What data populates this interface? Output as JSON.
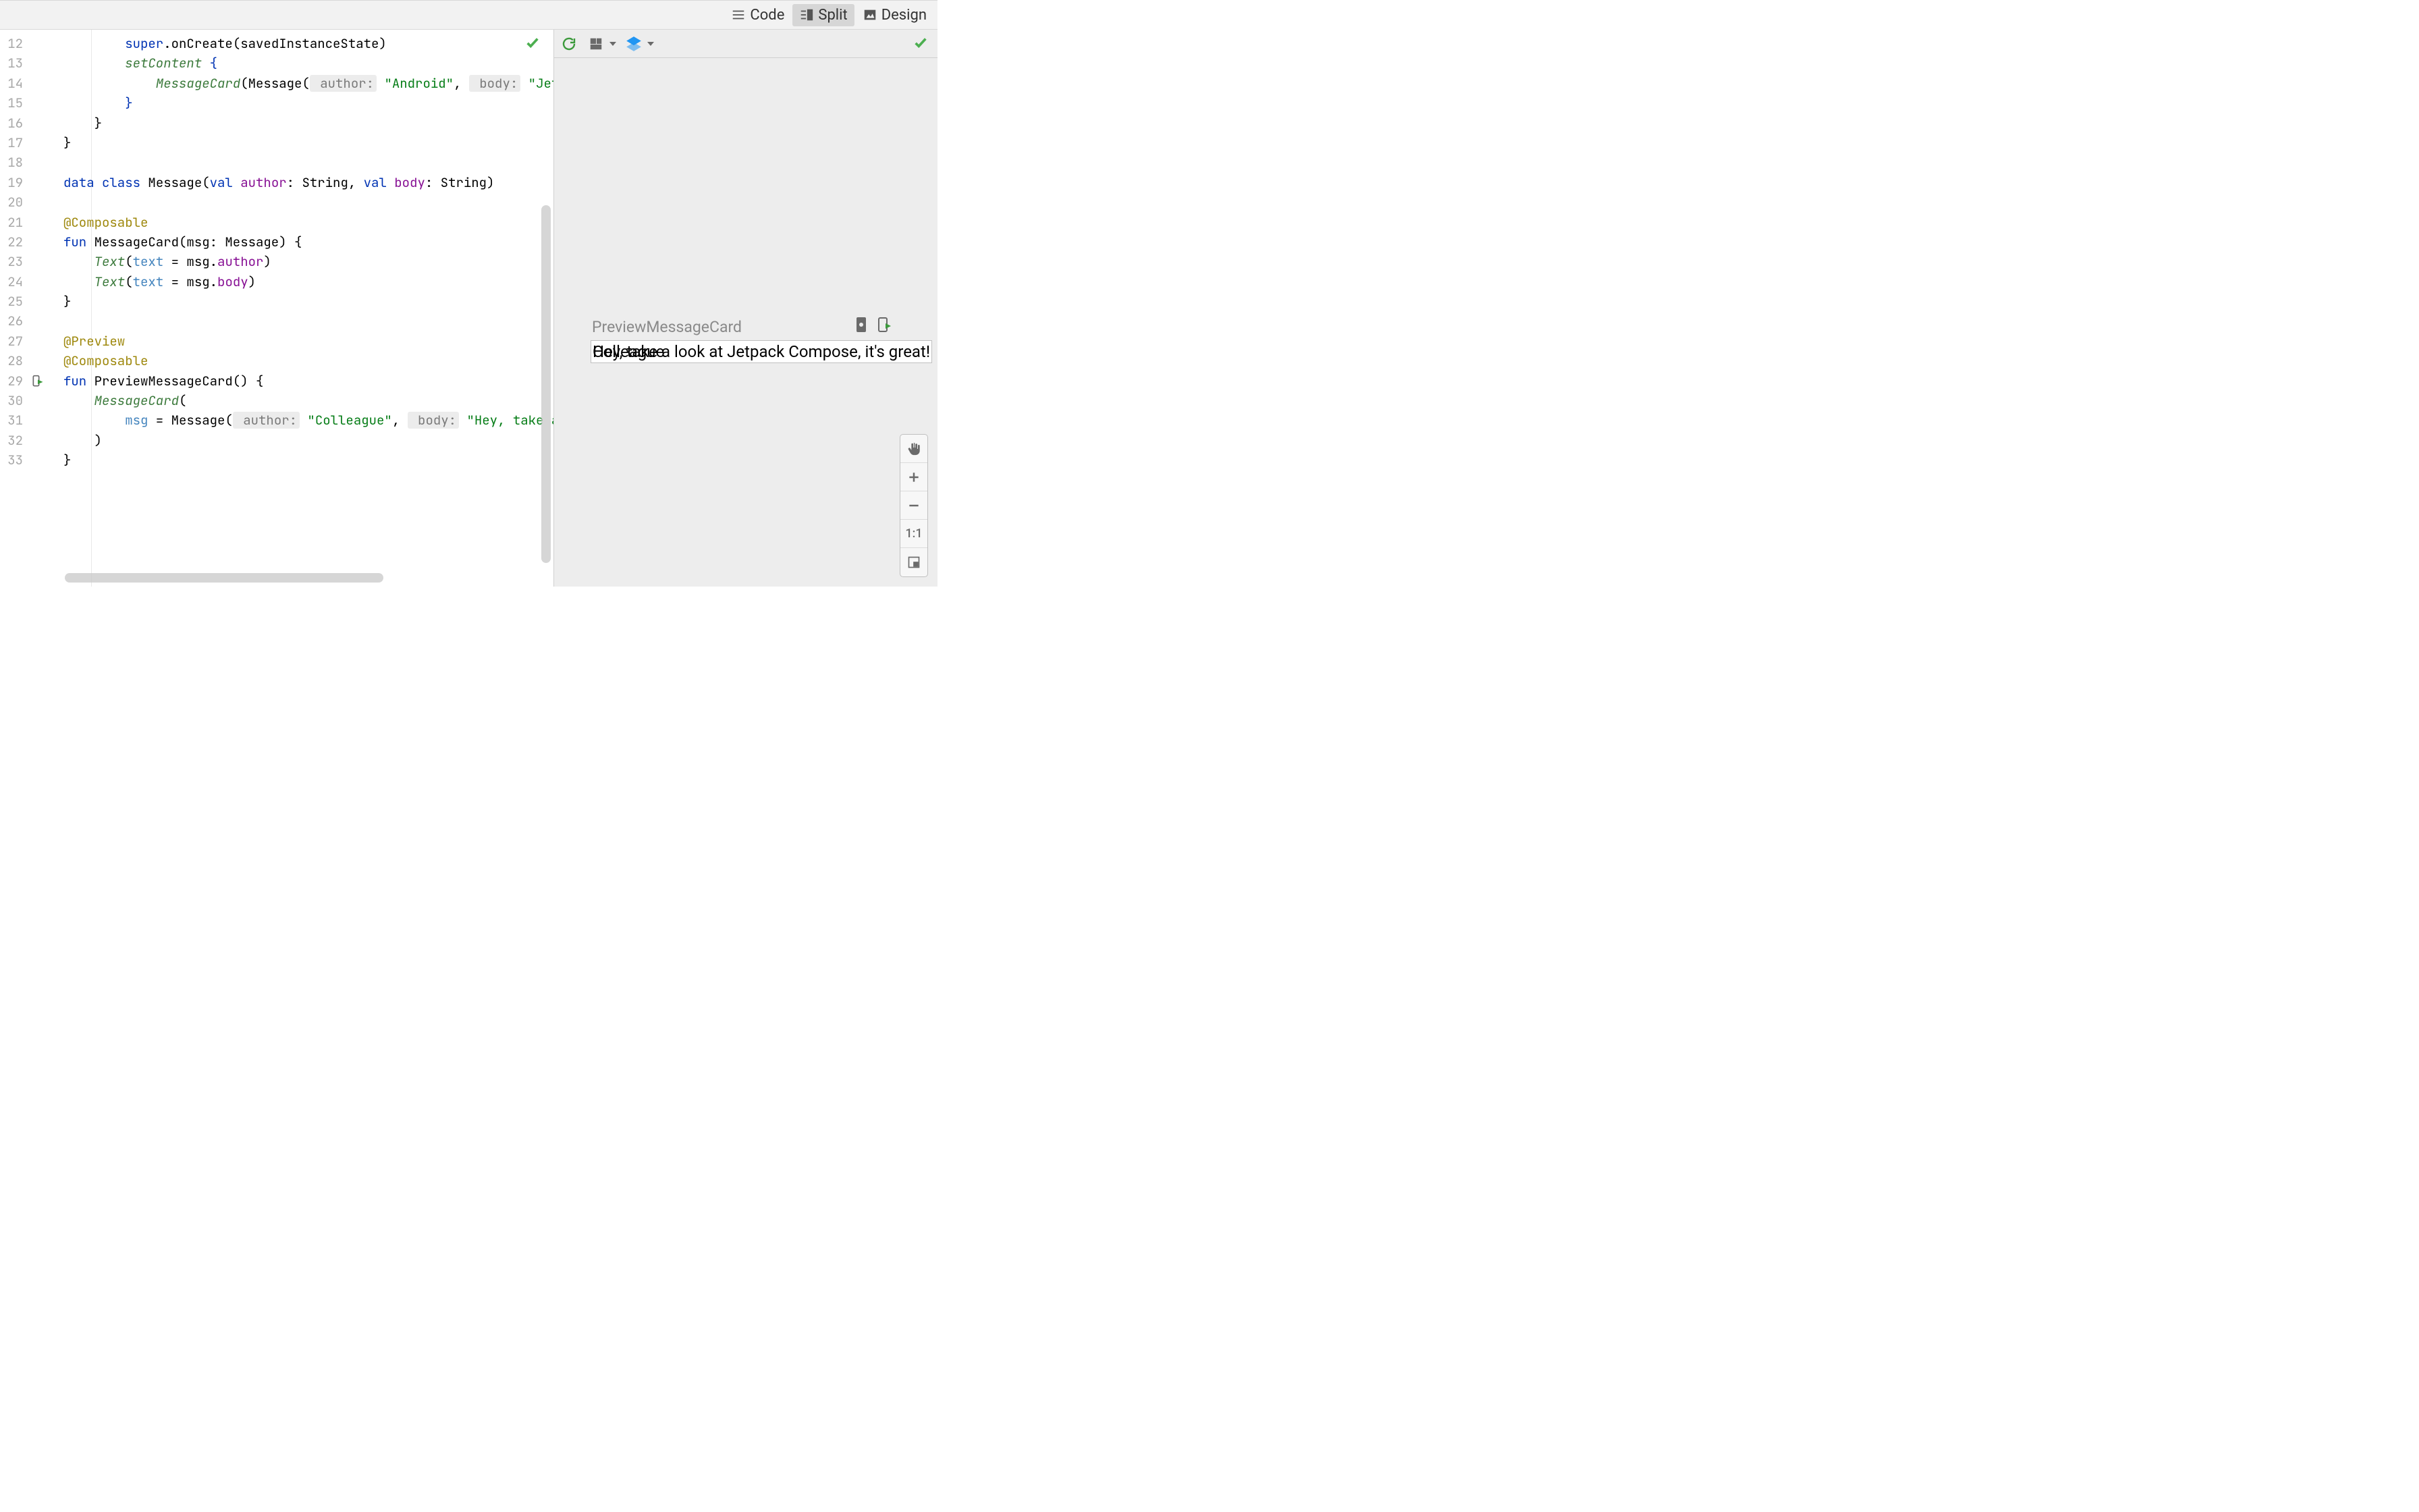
{
  "top": {
    "modes": {
      "code": "Code",
      "split": "Split",
      "design": "Design",
      "active": "split"
    }
  },
  "editor": {
    "first_line": 12,
    "run_gutter_line": 29,
    "lines": [
      {
        "i": "        ",
        "t": [
          {
            "c": "kwsuper",
            "v": "super"
          },
          {
            "c": "",
            "v": ".onCreate(savedInstanceState)"
          }
        ]
      },
      {
        "i": "        ",
        "t": [
          {
            "c": "fn-call",
            "v": "setContent"
          },
          {
            "c": "",
            "v": " "
          },
          {
            "c": "kw",
            "v": "{"
          }
        ]
      },
      {
        "i": "            ",
        "t": [
          {
            "c": "fn-call",
            "v": "MessageCard"
          },
          {
            "c": "",
            "v": "(Message("
          },
          {
            "c": "param-hint",
            "v": " author:"
          },
          {
            "c": "",
            "v": " "
          },
          {
            "c": "str",
            "v": "\"Android\""
          },
          {
            "c": "",
            "v": ", "
          },
          {
            "c": "param-hint",
            "v": " body:"
          },
          {
            "c": "",
            "v": " "
          },
          {
            "c": "str",
            "v": "\"Jetpack Compose\""
          }
        ]
      },
      {
        "i": "        ",
        "t": [
          {
            "c": "kw",
            "v": "}"
          }
        ]
      },
      {
        "i": "    ",
        "t": [
          {
            "c": "",
            "v": "}"
          }
        ]
      },
      {
        "i": "",
        "t": [
          {
            "c": "",
            "v": "}"
          }
        ]
      },
      {
        "i": "",
        "t": []
      },
      {
        "i": "",
        "t": [
          {
            "c": "kw",
            "v": "data class"
          },
          {
            "c": "",
            "v": " Message("
          },
          {
            "c": "kw",
            "v": "val"
          },
          {
            "c": "",
            "v": " "
          },
          {
            "c": "member",
            "v": "author"
          },
          {
            "c": "",
            "v": ": String, "
          },
          {
            "c": "kw",
            "v": "val"
          },
          {
            "c": "",
            "v": " "
          },
          {
            "c": "member",
            "v": "body"
          },
          {
            "c": "",
            "v": ": String)"
          }
        ]
      },
      {
        "i": "",
        "t": []
      },
      {
        "i": "",
        "t": [
          {
            "c": "anno",
            "v": "@Composable"
          }
        ]
      },
      {
        "i": "",
        "t": [
          {
            "c": "kw",
            "v": "fun"
          },
          {
            "c": "",
            "v": " MessageCard(msg: Message) {"
          }
        ]
      },
      {
        "i": "    ",
        "t": [
          {
            "c": "fn-call",
            "v": "Text"
          },
          {
            "c": "",
            "v": "("
          },
          {
            "c": "named-arg",
            "v": "text"
          },
          {
            "c": "",
            "v": " = msg."
          },
          {
            "c": "member",
            "v": "author"
          },
          {
            "c": "",
            "v": ")"
          }
        ]
      },
      {
        "i": "    ",
        "t": [
          {
            "c": "fn-call",
            "v": "Text"
          },
          {
            "c": "",
            "v": "("
          },
          {
            "c": "named-arg",
            "v": "text"
          },
          {
            "c": "",
            "v": " = msg."
          },
          {
            "c": "member",
            "v": "body"
          },
          {
            "c": "",
            "v": ")"
          }
        ]
      },
      {
        "i": "",
        "t": [
          {
            "c": "",
            "v": "}"
          }
        ]
      },
      {
        "i": "",
        "t": []
      },
      {
        "i": "",
        "t": [
          {
            "c": "anno",
            "v": "@Preview"
          }
        ]
      },
      {
        "i": "",
        "t": [
          {
            "c": "anno",
            "v": "@Composable"
          }
        ]
      },
      {
        "i": "",
        "t": [
          {
            "c": "kw",
            "v": "fun"
          },
          {
            "c": "",
            "v": " PreviewMessageCard() {"
          }
        ]
      },
      {
        "i": "    ",
        "t": [
          {
            "c": "fn-call",
            "v": "MessageCard"
          },
          {
            "c": "",
            "v": "("
          }
        ]
      },
      {
        "i": "        ",
        "t": [
          {
            "c": "named-arg",
            "v": "msg"
          },
          {
            "c": "",
            "v": " = Message("
          },
          {
            "c": "param-hint",
            "v": " author:"
          },
          {
            "c": "",
            "v": " "
          },
          {
            "c": "str",
            "v": "\"Colleague\""
          },
          {
            "c": "",
            "v": ", "
          },
          {
            "c": "param-hint",
            "v": " body:"
          },
          {
            "c": "",
            "v": " "
          },
          {
            "c": "str",
            "v": "\"Hey, take a look at"
          }
        ]
      },
      {
        "i": "    ",
        "t": [
          {
            "c": "",
            "v": ")"
          }
        ]
      },
      {
        "i": "",
        "t": [
          {
            "c": "",
            "v": "}"
          }
        ]
      }
    ]
  },
  "preview": {
    "label": "PreviewMessageCard",
    "render_text_author": "Colleague",
    "render_text_body": "Hey, take a look at Jetpack Compose, it's great!"
  },
  "zoom": {
    "one_to_one": "1:1"
  }
}
